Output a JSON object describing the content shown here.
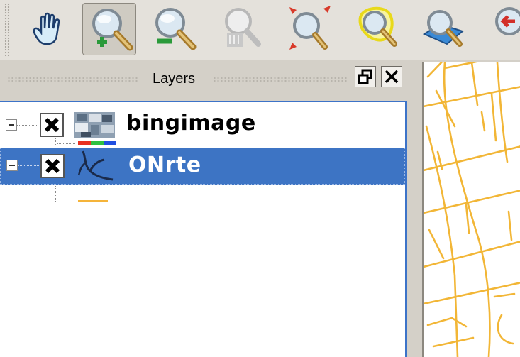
{
  "toolbar": {
    "tools": [
      {
        "name": "pan-tool",
        "icon": "hand-icon"
      },
      {
        "name": "zoom-in-tool",
        "icon": "zoom-in-icon",
        "active": true
      },
      {
        "name": "zoom-out-tool",
        "icon": "zoom-out-icon"
      },
      {
        "name": "zoom-actual-tool",
        "icon": "zoom-actual-size-icon"
      },
      {
        "name": "zoom-full-tool",
        "icon": "zoom-full-extent-icon"
      },
      {
        "name": "zoom-selection-tool",
        "icon": "zoom-to-selection-icon"
      },
      {
        "name": "zoom-layer-tool",
        "icon": "zoom-to-layer-icon"
      },
      {
        "name": "zoom-last-tool",
        "icon": "zoom-last-icon"
      }
    ]
  },
  "layers_panel": {
    "title": "Layers",
    "float_button_icon": "float-panel-icon",
    "close_button_icon": "close-icon",
    "layers": [
      {
        "label": "bingimage",
        "visible": true,
        "selected": false,
        "icon": "raster-layer-icon",
        "legend_colors": [
          "#e83020",
          "#2ec040",
          "#1f4fe0"
        ]
      },
      {
        "label": "ONrte",
        "visible": true,
        "selected": true,
        "icon": "line-layer-icon",
        "legend_color": "#f5b43a"
      }
    ]
  },
  "map": {
    "road_color": "#f2b636",
    "background": "#ffffff"
  }
}
